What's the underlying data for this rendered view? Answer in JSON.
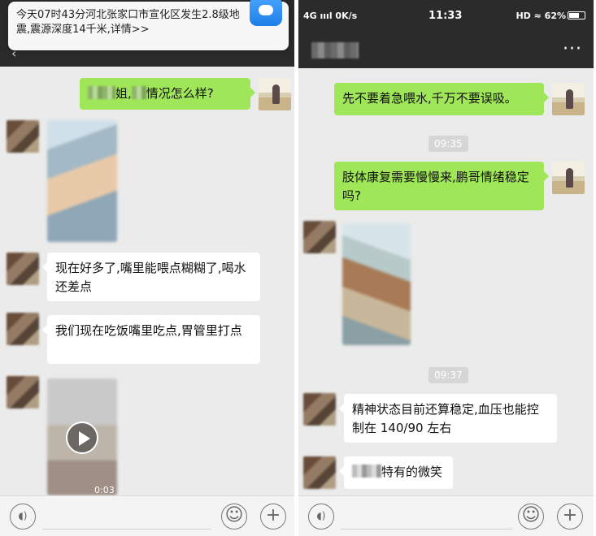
{
  "left": {
    "notification": {
      "text": "今天07时43分河北张家口市宣化区发生2.8级地震,震源深度14千米,详情>>"
    },
    "messages": {
      "m1": {
        "suffix": "姐,",
        "rest": "情况怎么样?"
      },
      "m2": "现在好多了,嘴里能喂点糊糊了,喝水还差点",
      "m3": "我们现在吃饭嘴里吃点,胃管里打点"
    },
    "video_time": "0:03"
  },
  "right": {
    "status": {
      "left": "4G ıııl 0K/s",
      "time": "11:33",
      "right": "HD ≈ 62%",
      "battery_percent": 62
    },
    "messages": {
      "m1": "先不要着急喂水,千万不要误吸。",
      "ts1": "09:35",
      "m2": "肢体康复需要慢慢来,鹏哥情绪稳定吗?",
      "ts2": "09:37",
      "m3": "精神状态目前还算稳定,血压也能控制在 140/90 左右",
      "m4": "特有的微笑"
    }
  },
  "icons": {
    "voice": "voice-icon",
    "emoji": "emoji-icon",
    "add": "add-icon",
    "more": "more-icon",
    "play": "play-icon"
  }
}
